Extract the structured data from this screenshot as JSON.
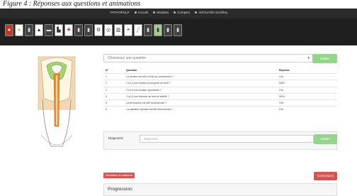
{
  "caption": "Figure 4 : Réponses aux questions et animations",
  "nav": {
    "items": [
      "PATHOPULP",
      "Accueil",
      "Modules",
      "Comptes",
      "ARGUARD Geoffrey"
    ]
  },
  "toolbar": {
    "tools": [
      "opening-tool",
      "probe-tool",
      "file-tool",
      "broach-tool",
      "syringe-tool",
      "irrigation-tool",
      "shaping-tool",
      "rotary-tool",
      "filling-tool",
      "gauge-tool",
      "measure-tool",
      "drill-tool",
      "cone-tool",
      "paper-point-tool",
      "lentulo-tool",
      "condenser-tool",
      "sealer-tool",
      "xray-tool"
    ]
  },
  "question_select": {
    "placeholder": "Choisissez une question",
    "button": "valider"
  },
  "table": {
    "headers": [
      "N°",
      "Question",
      "Réponse"
    ],
    "rows": [
      [
        "1",
        "La douleur est-elle à froid ou consécutive ?",
        "OUI"
      ],
      [
        "2",
        "Y a-t-il une douleur provoquée au froid ?",
        "NON"
      ],
      [
        "3",
        "Y a-t-il une douleur spontanée ?",
        "OUI"
      ],
      [
        "4",
        "Y a-t-il une réponse au test de vitalité ?",
        "NON"
      ],
      [
        "5",
        "La percussion est-elle douloureuse ?",
        "OUI"
      ],
      [
        "6",
        "La palpation apicale est-elle douloureuse ?",
        "OUI"
      ]
    ]
  },
  "diagnosis": {
    "label": "Diagnostic",
    "placeholder": "diagnostic",
    "button": "valider"
  },
  "reset_button": "Réinitialiser le traitement",
  "correct_button": "Corrections",
  "progression": {
    "title": "Progression"
  }
}
